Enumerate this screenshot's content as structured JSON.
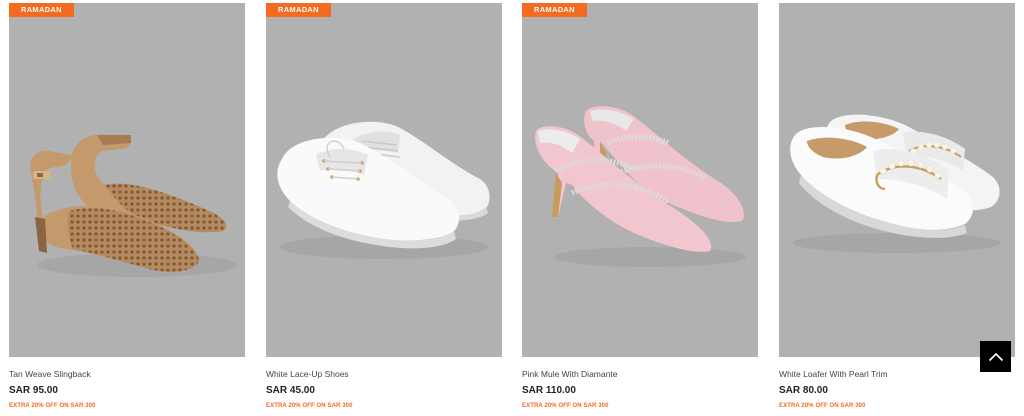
{
  "products": [
    {
      "badge": "RAMADAN",
      "name": "Tan Weave Slingback",
      "price": "SAR 95.00",
      "promo": "EXTRA 20% OFF ON SAR 300",
      "image": "tan-weave-slingback-image"
    },
    {
      "badge": "RAMADAN",
      "name": "White Lace-Up Shoes",
      "price": "SAR 45.00",
      "promo": "EXTRA 20% OFF ON SAR 300",
      "image": "white-lace-up-shoes-image"
    },
    {
      "badge": "RAMADAN",
      "name": "Pink Mule With Diamante",
      "price": "SAR 110.00",
      "promo": "EXTRA 20% OFF ON SAR 300",
      "image": "pink-mule-image"
    },
    {
      "badge": "",
      "name": "White Loafer With Pearl Trim",
      "price": "SAR 80.00",
      "promo": "EXTRA 20% OFF ON SAR 300",
      "image": "white-loafer-image"
    }
  ],
  "scroll_top": {
    "icon": "chevron-up-icon"
  },
  "colors": {
    "badge": "#f46a1e",
    "promo": "#f46a1e",
    "image_bg": "#b1b1b1",
    "scroll_button": "#000000"
  }
}
